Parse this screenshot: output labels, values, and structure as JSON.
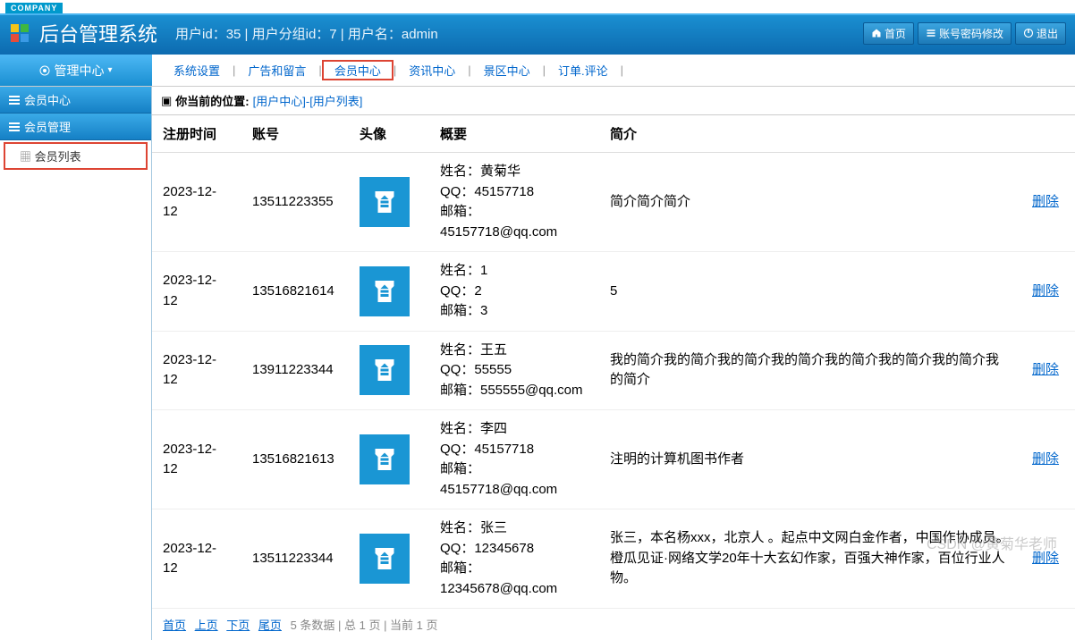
{
  "company_badge": "COMPANY",
  "header": {
    "title": "后台管理系统",
    "info": "用户id：35 | 用户分组id：7 | 用户名：admin",
    "home_btn": "首页",
    "password_btn": "账号密码修改",
    "logout_btn": "退出"
  },
  "nav": {
    "left_label": "管理中心",
    "items": [
      "系统设置",
      "广告和留言",
      "会员中心",
      "资讯中心",
      "景区中心",
      "订单.评论"
    ]
  },
  "sidebar": {
    "section1": "会员中心",
    "section2": "会员管理",
    "item1": "会员列表"
  },
  "breadcrumb": {
    "label": "你当前的位置:",
    "path": "[用户中心]-[用户列表]"
  },
  "table": {
    "headers": {
      "reg_time": "注册时间",
      "account": "账号",
      "avatar": "头像",
      "summary": "概要",
      "intro": "简介",
      "action": ""
    },
    "name_label": "姓名：",
    "qq_label": "QQ：",
    "email_label": "邮箱：",
    "delete_label": "删除",
    "rows": [
      {
        "reg_time": "2023-12-12",
        "account": "13511223355",
        "name": "黄菊华",
        "qq": "45157718",
        "email": "45157718@qq.com",
        "intro": "简介简介简介"
      },
      {
        "reg_time": "2023-12-12",
        "account": "13516821614",
        "name": "1",
        "qq": "2",
        "email": "3",
        "intro": "5"
      },
      {
        "reg_time": "2023-12-12",
        "account": "13911223344",
        "name": "王五",
        "qq": "55555",
        "email": "555555@qq.com",
        "intro": "我的简介我的简介我的简介我的简介我的简介我的简介我的简介我的简介"
      },
      {
        "reg_time": "2023-12-12",
        "account": "13516821613",
        "name": "李四",
        "qq": "45157718",
        "email": "45157718@qq.com",
        "intro": "注明的计算机图书作者"
      },
      {
        "reg_time": "2023-12-12",
        "account": "13511223344",
        "name": "张三",
        "qq": "12345678",
        "email": "12345678@qq.com",
        "intro": "张三，本名杨xxx，北京人 。起点中文网白金作者，中国作协成员。橙瓜见证·网络文学20年十大玄幻作家，百强大神作家，百位行业人物。"
      }
    ]
  },
  "pager": {
    "first": "首页",
    "prev": "上页",
    "next": "下页",
    "last": "尾页",
    "info": "5 条数据 | 总 1 页 | 当前 1 页"
  },
  "watermark": "CSDN @黄菊华老师"
}
